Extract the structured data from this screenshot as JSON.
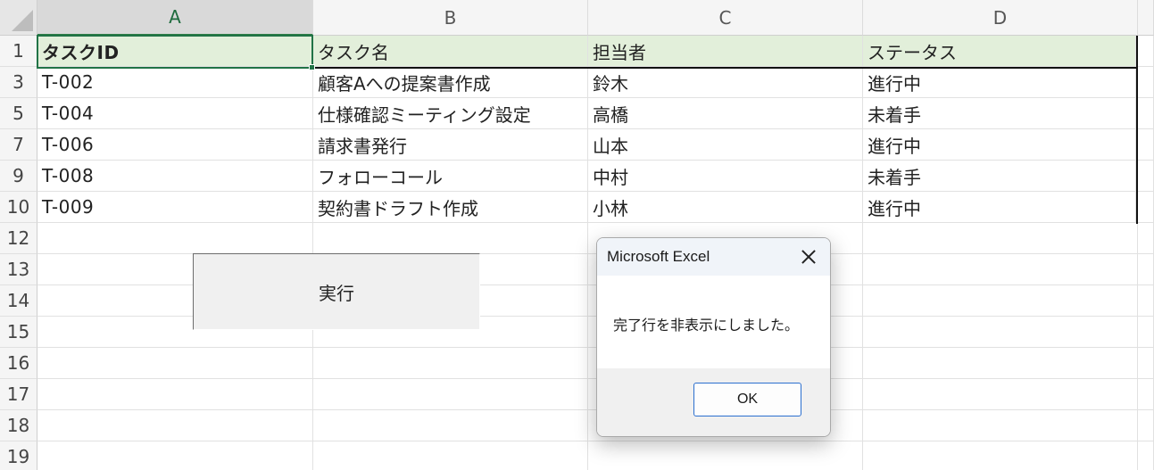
{
  "columns": [
    "A",
    "B",
    "C",
    "D"
  ],
  "header_row": {
    "row_num": "1",
    "cells": [
      "タスクID",
      "タスク名",
      "担当者",
      "ステータス"
    ]
  },
  "rows": [
    {
      "row_num": "3",
      "cells": [
        "T-002",
        "顧客Aへの提案書作成",
        "鈴木",
        "進行中"
      ]
    },
    {
      "row_num": "5",
      "cells": [
        "T-004",
        "仕様確認ミーティング設定",
        "高橋",
        "未着手"
      ]
    },
    {
      "row_num": "7",
      "cells": [
        "T-006",
        "請求書発行",
        "山本",
        "進行中"
      ]
    },
    {
      "row_num": "9",
      "cells": [
        "T-008",
        "フォローコール",
        "中村",
        "未着手"
      ]
    },
    {
      "row_num": "10",
      "cells": [
        "T-009",
        "契約書ドラフト作成",
        "小林",
        "進行中"
      ]
    }
  ],
  "empty_rows": [
    "12",
    "13",
    "14",
    "15",
    "16",
    "17",
    "18",
    "19"
  ],
  "run_button": {
    "label": "実行"
  },
  "dialog": {
    "title": "Microsoft Excel",
    "message": "完了行を非表示にしました。",
    "ok_label": "OK"
  },
  "colors": {
    "header_fill": "#e2efda",
    "selection_green": "#217346",
    "ok_border": "#2b6fcf"
  }
}
